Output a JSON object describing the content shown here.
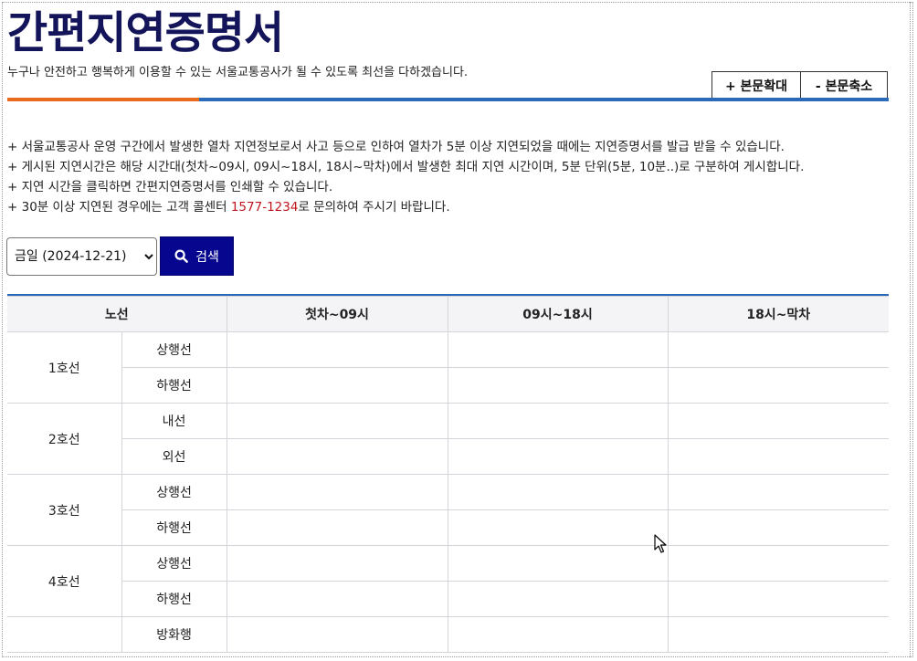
{
  "header": {
    "title": "간편지연증명서",
    "subtitle": "누구나 안전하고 행복하게 이용할 수 있는 서울교통공사가 될 수 있도록 최선을 다하겠습니다.",
    "zoom_in_label": "+ 본문확대",
    "zoom_out_label": "- 본문축소"
  },
  "notices": [
    "+ 서울교통공사 운영 구간에서 발생한 열차 지연정보로서 사고 등으로 인하여 열차가 5분 이상 지연되었을 때에는 지연증명서를 발급 받을 수 있습니다.",
    "+ 게시된 지연시간은 해당 시간대(첫차~09시, 09시~18시, 18시~막차)에서 발생한 최대 지연 시간이며, 5분 단위(5분, 10분..)로 구분하여 게시합니다.",
    "+ 지연 시간을 클릭하면 간편지연증명서를 인쇄할 수 있습니다."
  ],
  "notice_contact": {
    "before": "+ 30분 이상 지연된 경우에는 고객 콜센터 ",
    "phone": "1577-1234",
    "after": "로 문의하여 주시기 바랍니다."
  },
  "search": {
    "date_selected": "금일 (2024-12-21)",
    "button_label": "검색",
    "icon": "search-icon"
  },
  "table": {
    "headers": [
      "노선",
      "첫차~09시",
      "09시~18시",
      "18시~막차"
    ],
    "lines": [
      {
        "name": "1호선",
        "directions": [
          "상행선",
          "하행선"
        ]
      },
      {
        "name": "2호선",
        "directions": [
          "내선",
          "외선"
        ]
      },
      {
        "name": "3호선",
        "directions": [
          "상행선",
          "하행선"
        ]
      },
      {
        "name": "4호선",
        "directions": [
          "상행선",
          "하행선"
        ]
      },
      {
        "name": "",
        "directions": [
          "방화행"
        ]
      }
    ]
  },
  "colors": {
    "title": "#14145a",
    "accent_orange": "#e86a1c",
    "accent_blue": "#2a6ab8",
    "search_button": "#06068e",
    "phone": "#c0151d"
  }
}
